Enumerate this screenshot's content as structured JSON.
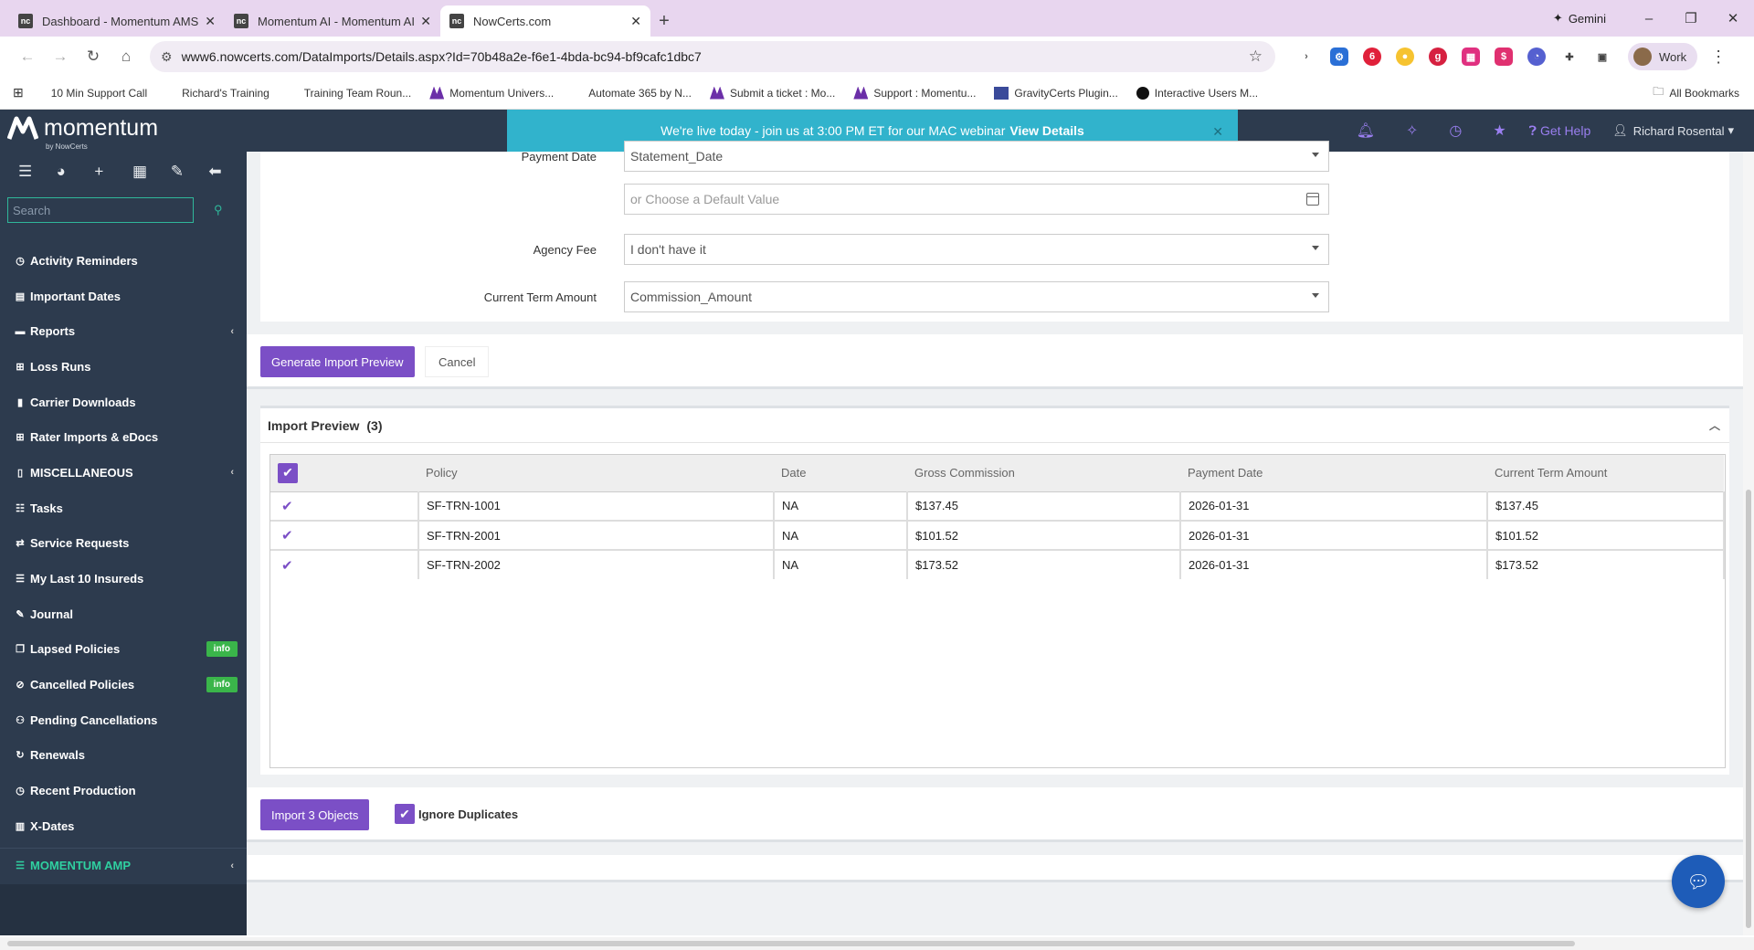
{
  "browser": {
    "tabs": [
      {
        "title": "Dashboard - Momentum AMS",
        "icon": "nc-favicon"
      },
      {
        "title": "Momentum AI - Momentum AI",
        "icon": "nc-favicon"
      },
      {
        "title": "NowCerts.com",
        "icon": "nc-favicon",
        "active": true
      }
    ],
    "gemini_label": "Gemini",
    "url": "www6.nowcerts.com/DataImports/Details.aspx?Id=70b48a2e-f6e1-4bda-bc94-bf9cafc1dbc7",
    "profile_label": "Work",
    "bookmarks": [
      "10 Min Support Call",
      "Richard's Training",
      "Training Team Roun...",
      "Momentum Univers...",
      "Automate 365 by N...",
      "Submit a ticket : Mo...",
      "Support : Momentu...",
      "GravityCerts Plugin...",
      "Interactive Users M..."
    ],
    "all_bookmarks": "All Bookmarks"
  },
  "header": {
    "logo_text": "momentum",
    "logo_sub": "by NowCerts",
    "banner_text": "We're live today - join us at 3:00 PM ET for our MAC webinar",
    "banner_link": "View Details",
    "help_label": "Get Help",
    "user_name": "Richard Rosental"
  },
  "sidebar": {
    "search_placeholder": "Search",
    "items": [
      {
        "label": "Activity Reminders",
        "icon": "clock-icon"
      },
      {
        "label": "Important Dates",
        "icon": "calendar-icon"
      },
      {
        "label": "Reports",
        "icon": "folder-icon",
        "chevron": true
      },
      {
        "label": "Loss Runs",
        "icon": "grid-icon"
      },
      {
        "label": "Carrier Downloads",
        "icon": "file-icon"
      },
      {
        "label": "Rater Imports & eDocs",
        "icon": "import-icon"
      },
      {
        "label": "MISCELLANEOUS",
        "icon": "document-icon",
        "chevron": true
      },
      {
        "label": "Tasks",
        "icon": "tasks-icon"
      },
      {
        "label": "Service Requests",
        "icon": "exchange-icon"
      },
      {
        "label": "My Last 10 Insureds",
        "icon": "list-icon"
      },
      {
        "label": "Journal",
        "icon": "pencil-icon"
      },
      {
        "label": "Lapsed Policies",
        "icon": "copy-icon",
        "badge": "info"
      },
      {
        "label": "Cancelled Policies",
        "icon": "ban-icon",
        "badge": "info"
      },
      {
        "label": "Pending Cancellations",
        "icon": "users-icon"
      },
      {
        "label": "Renewals",
        "icon": "refresh-icon"
      },
      {
        "label": "Recent Production",
        "icon": "history-icon"
      },
      {
        "label": "X-Dates",
        "icon": "chart-icon"
      }
    ],
    "amp": {
      "label": "MOMENTUM AMP",
      "icon": "menu-icon"
    }
  },
  "form": {
    "payment_date_label": "Payment Date",
    "payment_date_value": "Statement_Date",
    "default_value_placeholder": "or Choose a Default Value",
    "agency_fee_label": "Agency Fee",
    "agency_fee_value": "I don't have it",
    "current_term_label": "Current Term Amount",
    "current_term_value": "Commission_Amount",
    "generate_button": "Generate Import Preview",
    "cancel_button": "Cancel"
  },
  "preview": {
    "title": "Import Preview",
    "count": "(3)",
    "columns": [
      "Policy",
      "Date",
      "Gross Commission",
      "Payment Date",
      "Current Term Amount"
    ],
    "rows": [
      {
        "policy": "SF-TRN-1001",
        "date": "NA",
        "gross": "$137.45",
        "payment": "2026-01-31",
        "term": "$137.45"
      },
      {
        "policy": "SF-TRN-2001",
        "date": "NA",
        "gross": "$101.52",
        "payment": "2026-01-31",
        "term": "$101.52"
      },
      {
        "policy": "SF-TRN-2002",
        "date": "NA",
        "gross": "$173.52",
        "payment": "2026-01-31",
        "term": "$173.52"
      }
    ]
  },
  "footer": {
    "import_button": "Import 3 Objects",
    "ignore_duplicates_label": "Ignore Duplicates",
    "ignore_duplicates_checked": true
  },
  "colors": {
    "accent": "#7b4fc6",
    "sidebar_bg": "#2d3b4e",
    "banner_bg": "#31b3cc",
    "badge_green": "#3ab54a"
  }
}
